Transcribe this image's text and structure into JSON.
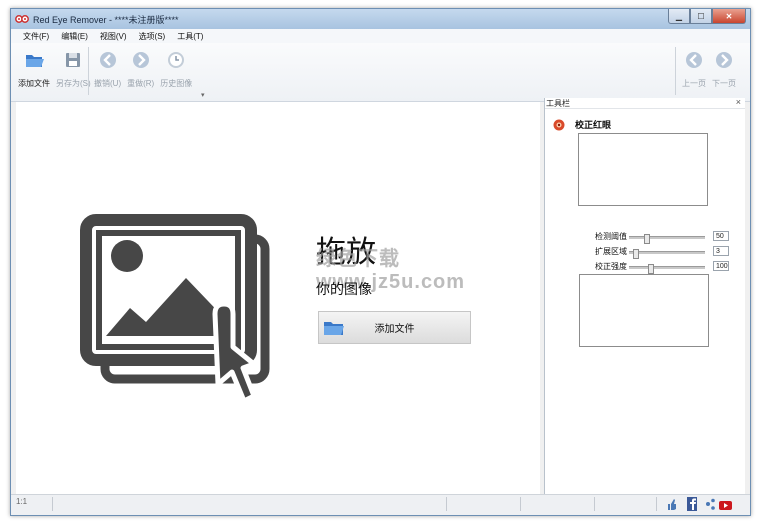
{
  "window": {
    "title": "Red Eye Remover - ****未注册版****"
  },
  "menu": [
    "文件(F)",
    "编辑(E)",
    "视图(V)",
    "选项(S)",
    "工具(T)"
  ],
  "toolbar": {
    "add_file": "添加文件",
    "save_as": "另存为(S)",
    "undo": "撤销(U)",
    "redo": "重做(R)",
    "history": "历史图像",
    "prev": "上一页",
    "next": "下一页"
  },
  "drop": {
    "title": "拖放",
    "subtitle": "你的图像",
    "button": "添加文件",
    "watermark": "绿色下载 www.jz5u.com"
  },
  "panel": {
    "title": "工具栏",
    "close": "×",
    "redeye_label": "校正红眼",
    "sliders": [
      {
        "label": "检测阈值",
        "value": "50",
        "level": 0.2
      },
      {
        "label": "扩展区域",
        "value": "3",
        "level": 0.05
      },
      {
        "label": "校正强度",
        "value": "100",
        "level": 0.25
      }
    ]
  },
  "status": {
    "zoom": "1:1"
  },
  "colors": {
    "titlebar": "#b8cfe8",
    "accent": "#cc3322",
    "icon_dark": "#474747"
  }
}
